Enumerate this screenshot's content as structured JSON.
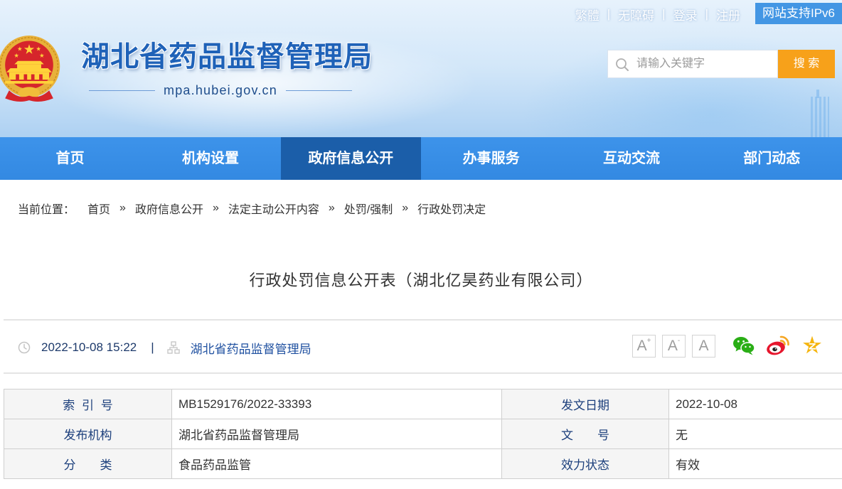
{
  "top_links": {
    "traditional": "繁體",
    "accessibility": "无障碍",
    "login": "登录",
    "register": "注册",
    "separator": "|",
    "ipv6_badge": "网站支持IPv6"
  },
  "site": {
    "title": "湖北省药品监督管理局",
    "domain": "mpa.hubei.gov.cn"
  },
  "search": {
    "placeholder": "请输入关键字",
    "value": "",
    "button_label": "搜 索",
    "icon": "search-icon"
  },
  "nav": [
    {
      "label": "首页",
      "active": false
    },
    {
      "label": "机构设置",
      "active": false
    },
    {
      "label": "政府信息公开",
      "active": true
    },
    {
      "label": "办事服务",
      "active": false
    },
    {
      "label": "互动交流",
      "active": false
    },
    {
      "label": "部门动态",
      "active": false
    }
  ],
  "breadcrumb": {
    "prefix": "当前位置：",
    "separator": "»",
    "items": [
      "首页",
      "政府信息公开",
      "法定主动公开内容",
      "处罚/强制",
      "行政处罚决定"
    ]
  },
  "article": {
    "title": "行政处罚信息公开表（湖北亿昊药业有限公司）",
    "datetime": "2022-10-08 15:22",
    "divider": "|",
    "source": "湖北省药品监督管理局",
    "date_icon": "clock-icon",
    "source_icon": "organization-icon"
  },
  "font_size_controls": [
    {
      "letter": "A",
      "sup": "+",
      "icon": "font-increase-icon"
    },
    {
      "letter": "A",
      "sup": "-",
      "icon": "font-decrease-icon"
    },
    {
      "letter": "A",
      "sup": "",
      "icon": "font-reset-icon"
    }
  ],
  "share": [
    "wechat-icon",
    "weibo-icon",
    "qzone-icon"
  ],
  "info_table": {
    "rows": [
      [
        {
          "label": "索 引 号",
          "value": "MB1529176/2022-33393"
        },
        {
          "label": "发文日期",
          "value": "2022-10-08"
        }
      ],
      [
        {
          "label": "发布机构",
          "value": "湖北省药品监督管理局"
        },
        {
          "label": "文　　号",
          "value": "无"
        }
      ],
      [
        {
          "label": "分　　类",
          "value": "食品药品监管"
        },
        {
          "label": "效力状态",
          "value": "有效"
        }
      ]
    ]
  },
  "colors": {
    "nav_bg": "#3a8fe6",
    "nav_active_bg": "#1b5ea9",
    "site_title": "#1f62b8",
    "search_button": "#f7a11a",
    "table_label_text": "#1c3f7c",
    "source_link": "#1f50a0"
  }
}
